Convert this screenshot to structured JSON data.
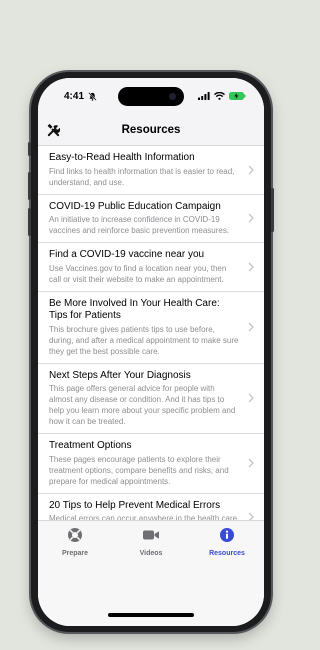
{
  "status_bar": {
    "time": "4:41"
  },
  "nav": {
    "title": "Resources"
  },
  "items": [
    {
      "title": "Easy-to-Read Health Information",
      "desc": "Find links to health information that is easier to read, understand, and use."
    },
    {
      "title": "COVID-19 Public Education Campaign",
      "desc": "An initiative to increase confidence in COVID-19 vaccines and reinforce basic prevention measures."
    },
    {
      "title": "Find a COVID-19 vaccine near you",
      "desc": "Use Vaccines.gov to find a location near you, then call or visit their website to make an appointment."
    },
    {
      "title": "Be More Involved In Your Health Care: Tips for Patients",
      "desc": "This brochure gives patients tips to use before, during, and after a medical appointment to make sure they get the best possible care."
    },
    {
      "title": "Next Steps After Your Diagnosis",
      "desc": "This page offers general advice for people with almost any disease or condition. And it has tips to help you learn more about your specific problem and how it can be treated."
    },
    {
      "title": "Treatment Options",
      "desc": "These pages encourage patients to explore their treatment options, compare benefits and risks, and prepare for medical appointments."
    },
    {
      "title": "20 Tips to Help Prevent Medical Errors",
      "desc": "Medical errors can occur anywhere in the health care system."
    }
  ],
  "tabs": [
    {
      "label": "Prepare",
      "icon": "lifebuoy-icon",
      "active": false
    },
    {
      "label": "Videos",
      "icon": "video-camera-icon",
      "active": false
    },
    {
      "label": "Resources",
      "icon": "info-icon",
      "active": true
    }
  ],
  "colors": {
    "accent": "#3a4bd6",
    "inactive": "#6e6e73",
    "chevron": "#c4c4c8"
  }
}
